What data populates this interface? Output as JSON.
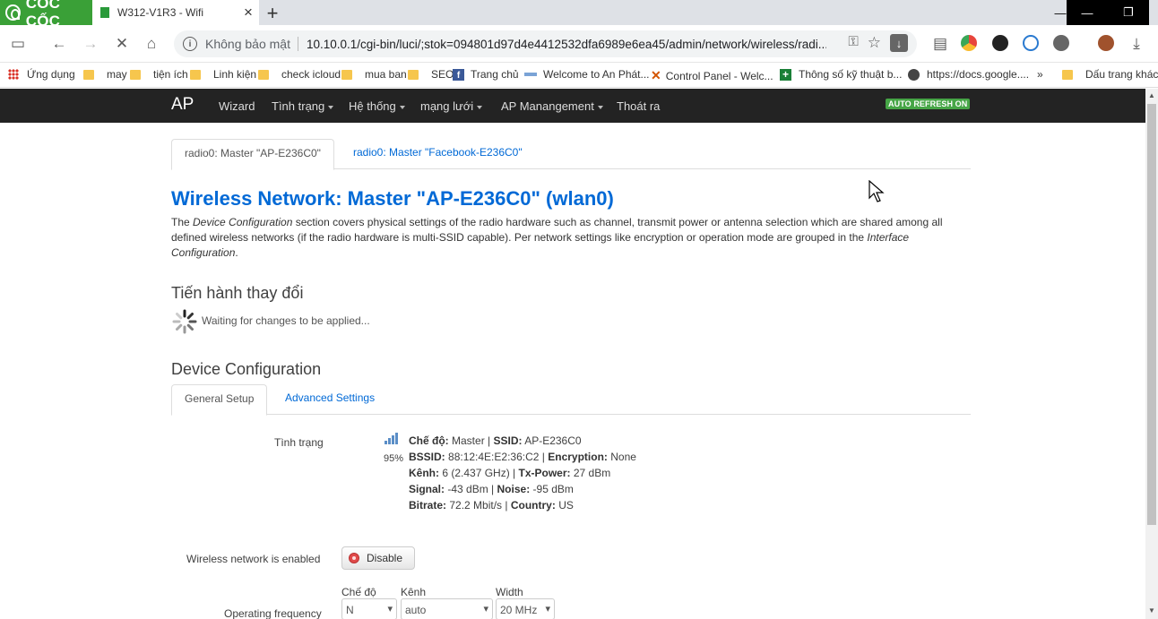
{
  "browser": {
    "brand": "CỐC CỐC",
    "tab_title": "W312-V1R3 - Wifi",
    "security_text": "Không bảo mật",
    "url": "10.10.0.1/cgi-bin/luci/;stok=094801d97d4e4412532dfa6989e6ea45/admin/network/wireless/radi..."
  },
  "bookmarks": {
    "items": [
      "Ứng dụng",
      "may",
      "tiện ích",
      "Linh kiện",
      "check icloud",
      "mua ban",
      "SEO",
      "Trang chủ",
      "Welcome to An Phát...",
      "Control Panel - Welc...",
      "Thông số kỹ thuật b...",
      "https://docs.google...."
    ],
    "more": "»",
    "other": "Dấu trang khác"
  },
  "nav": {
    "brand": "AP",
    "items": [
      "Wizard",
      "Tình trạng",
      "Hệ thống",
      "mạng lưới",
      "AP Manangement",
      "Thoát ra"
    ],
    "auto_refresh": "AUTO REFRESH ON"
  },
  "radio_tabs": [
    "radio0: Master \"AP-E236C0\"",
    "radio0: Master \"Facebook-E236C0\""
  ],
  "page": {
    "title": "Wireless Network: Master \"AP-E236C0\" (wlan0)",
    "desc_1": "The ",
    "desc_em1": "Device Configuration",
    "desc_2": " section covers physical settings of the radio hardware such as channel, transmit power or antenna selection which are shared among all defined wireless networks (if the radio hardware is multi-SSID capable). Per network settings like encryption or operation mode are grouped in the ",
    "desc_em2": "Interface Configuration",
    "desc_3": ".",
    "changes_heading": "Tiến hành thay đổi",
    "waiting_text": "Waiting for changes to be applied...",
    "device_config_heading": "Device Configuration"
  },
  "config_tabs": [
    "General Setup",
    "Advanced Settings"
  ],
  "status": {
    "label": "Tình trạng",
    "signal_percent": "95%",
    "mode_label": "Chế độ:",
    "mode_value": "Master",
    "ssid_label": "SSID:",
    "ssid_value": "AP-E236C0",
    "bssid_label": "BSSID:",
    "bssid_value": "88:12:4E:E2:36:C2",
    "enc_label": "Encryption:",
    "enc_value": "None",
    "channel_label": "Kênh:",
    "channel_value": "6 (2.437 GHz)",
    "txpower_label": "Tx-Power:",
    "txpower_value": "27 dBm",
    "signal_label": "Signal:",
    "signal_value": "-43 dBm",
    "noise_label": "Noise:",
    "noise_value": "-95 dBm",
    "bitrate_label": "Bitrate:",
    "bitrate_value": "72.2 Mbit/s",
    "country_label": "Country:",
    "country_value": "US",
    "sep": " | "
  },
  "wireless_enabled": {
    "label": "Wireless network is enabled",
    "button": "Disable"
  },
  "frequency": {
    "label": "Operating frequency",
    "mode_label": "Chế độ",
    "mode_value": "N",
    "channel_label": "Kênh",
    "channel_value": "auto",
    "width_label": "Width",
    "width_value": "20 MHz"
  },
  "colors": {
    "link": "#0069d6",
    "navbar": "#232323",
    "badge": "#46a546",
    "brand": "#3aa037"
  }
}
